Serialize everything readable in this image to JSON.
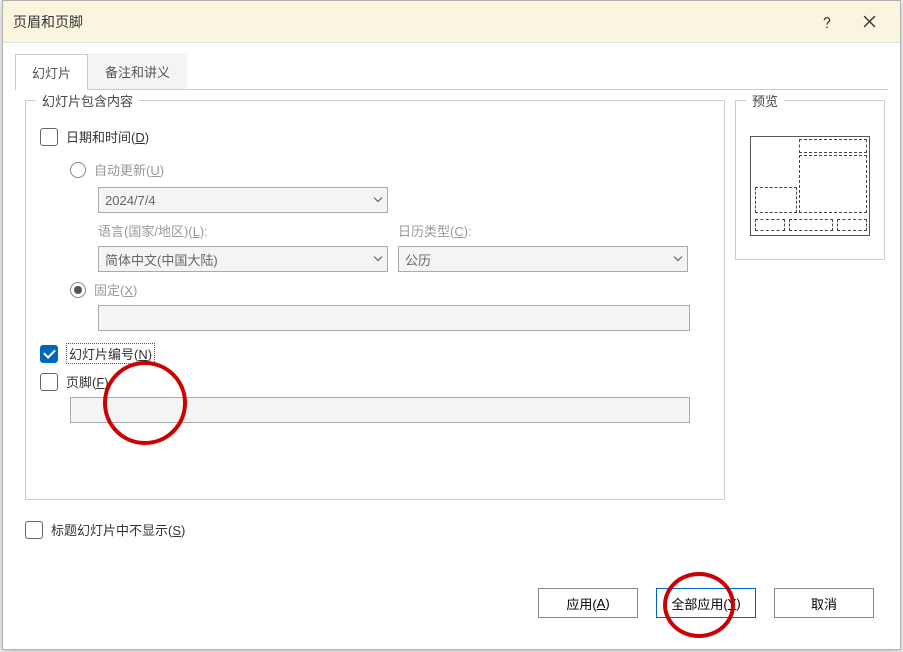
{
  "titlebar": {
    "title": "页眉和页脚"
  },
  "tabs": {
    "slide": "幻灯片",
    "notes": "备注和讲义"
  },
  "group_main": {
    "legend": "幻灯片包含内容"
  },
  "group_preview": {
    "legend": "预览"
  },
  "datetime": {
    "label_prefix": "日期和时间(",
    "label_key": "D",
    "label_suffix": ")",
    "auto_prefix": "自动更新(",
    "auto_key": "U",
    "auto_suffix": ")",
    "date_value": "2024/7/4",
    "lang_label_prefix": "语言(国家/地区)(",
    "lang_label_key": "L",
    "lang_label_suffix": "):",
    "lang_value": "简体中文(中国大陆)",
    "cal_label_prefix": "日历类型(",
    "cal_label_key": "C",
    "cal_label_suffix": "):",
    "cal_value": "公历",
    "fixed_prefix": "固定(",
    "fixed_key": "X",
    "fixed_suffix": ")",
    "fixed_value": ""
  },
  "slide_number": {
    "label1": "幻灯片编号(",
    "label_key": "N",
    "label2": ")"
  },
  "footer": {
    "label_prefix": "页脚(",
    "label_key": "F",
    "label_suffix": ")",
    "value": ""
  },
  "hide_title": {
    "label_prefix": "标题幻灯片中不显示(",
    "label_key": "S",
    "label_suffix": ")"
  },
  "buttons": {
    "apply_prefix": "应用(",
    "apply_key": "A",
    "apply_suffix": ")",
    "apply_all_prefix": "全部应用(",
    "apply_all_key": "Y",
    "apply_all_suffix": ")",
    "cancel": "取消"
  }
}
